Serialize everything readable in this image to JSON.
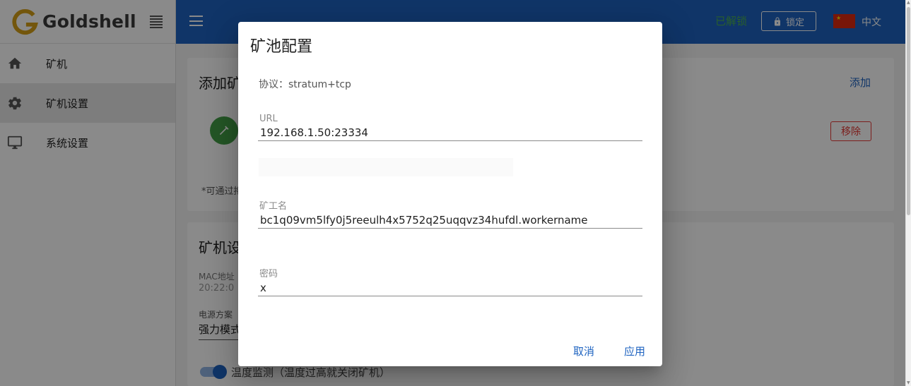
{
  "sidebar": {
    "brand_name": "Goldshell",
    "items": [
      {
        "label": "矿机",
        "icon": "home-icon"
      },
      {
        "label": "矿机设置",
        "icon": "gear-icon"
      },
      {
        "label": "系统设置",
        "icon": "monitor-icon"
      }
    ],
    "active_index": 1
  },
  "topbar": {
    "unlock_status": "已解锁",
    "lock_button": "锁定",
    "language": "中文",
    "flag_icon": "china-flag-icon"
  },
  "background": {
    "pool_card": {
      "title": "添加矿",
      "add_label": "添加",
      "remove_label": "移除",
      "hint": "*可通过拖"
    },
    "settings_card": {
      "title": "矿机设",
      "mac_label": "MAC地址",
      "mac_value": "20:22:0",
      "power_label": "电源方案",
      "power_value": "强力模式",
      "temp_toggle_label": "温度监测（温度过高就关闭矿机）",
      "temp_toggle_on": true
    }
  },
  "dialog": {
    "title": "矿池配置",
    "protocol": "协议：stratum+tcp",
    "url": {
      "label": "URL",
      "value": "192.168.1.50:23334"
    },
    "worker": {
      "label": "矿工名",
      "value": "bc1q09vm5lfy0j5reeulh4x5752q25uqqvz34hufdl.workername"
    },
    "password": {
      "label": "密码",
      "value": "x"
    },
    "cancel_label": "取消",
    "apply_label": "应用"
  },
  "colors": {
    "topbar": "#1e63c0",
    "accent": "#1e63c0",
    "unlock": "#4caf50",
    "danger": "#e53935",
    "brand_gold": "#d4a017"
  }
}
